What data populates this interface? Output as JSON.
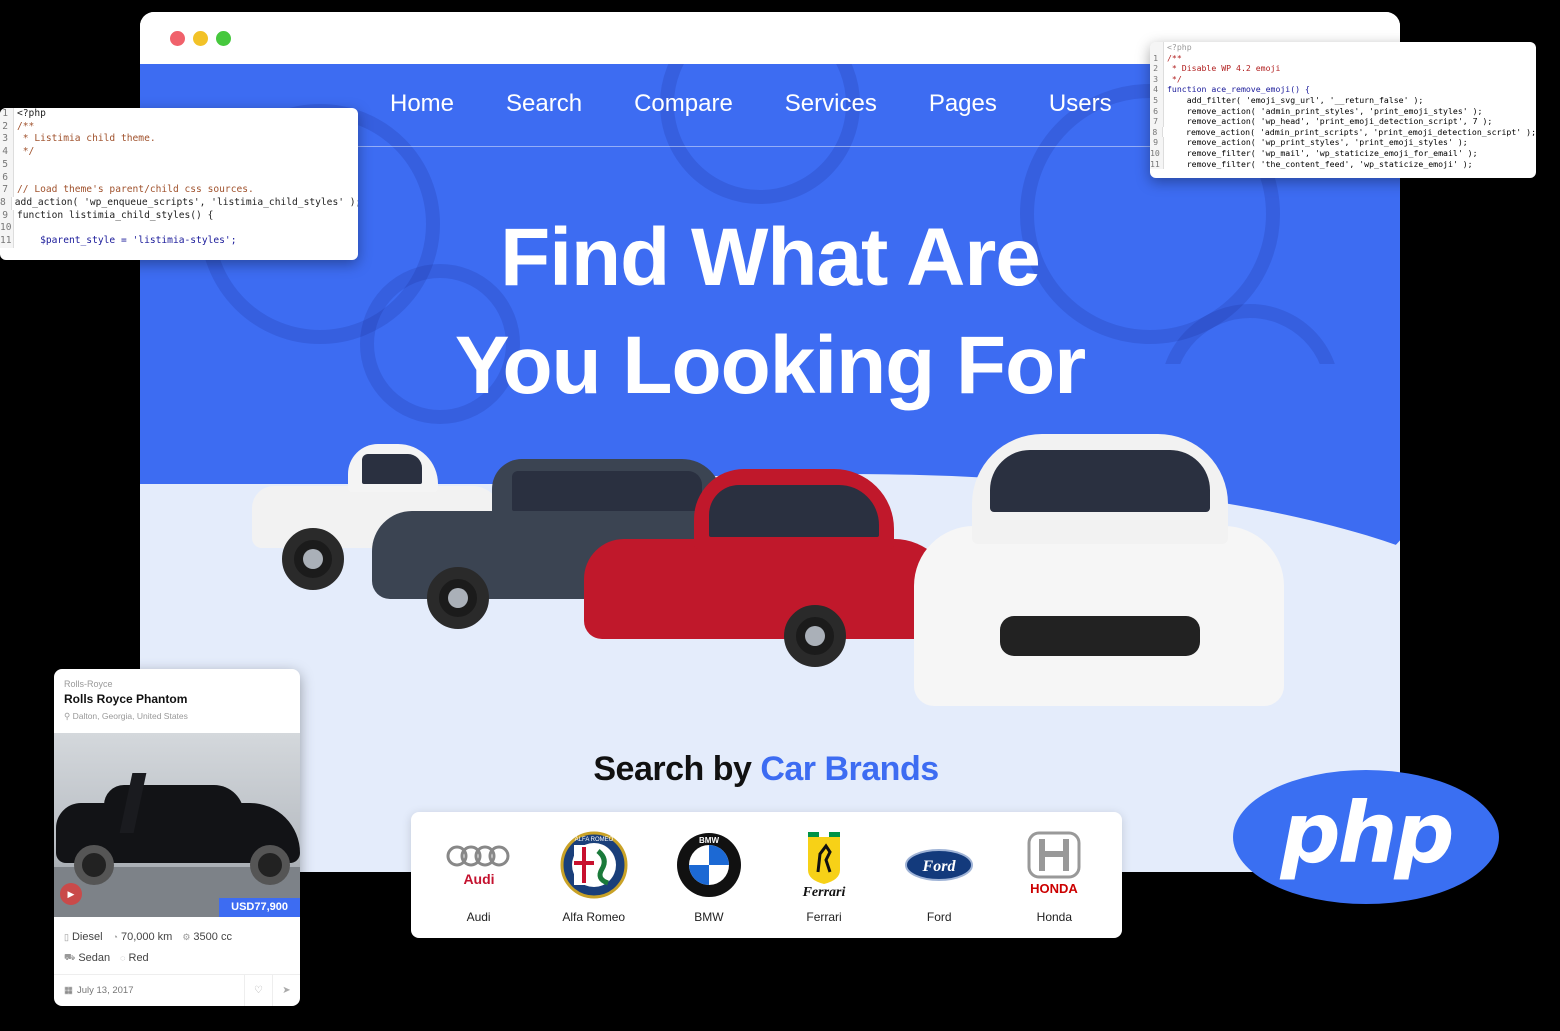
{
  "browser": {
    "nav": [
      "Home",
      "Search",
      "Compare",
      "Services",
      "Pages",
      "Users"
    ],
    "headline_line1": "Find What Are",
    "headline_line2": "You Looking For",
    "brands_heading_prefix": "Search by",
    "brands_heading_accent": "Car Brands",
    "brands": [
      {
        "name": "Audi",
        "logo_text": "Audi",
        "color": "#c4122f"
      },
      {
        "name": "Alfa Romeo",
        "logo_text": "ALFA ROMEO",
        "color": "#1a5b2b"
      },
      {
        "name": "BMW",
        "logo_text": "BMW",
        "color": "#1c69d4"
      },
      {
        "name": "Ferrari",
        "logo_text": "Ferrari",
        "color": "#f7d117"
      },
      {
        "name": "Ford",
        "logo_text": "Ford",
        "color": "#133a7c"
      },
      {
        "name": "Honda",
        "logo_text": "HONDA",
        "color": "#cc0000"
      }
    ]
  },
  "code_left": {
    "lines": [
      {
        "n": "1",
        "t": "<?php"
      },
      {
        "n": "2",
        "t": "/**"
      },
      {
        "n": "3",
        "t": " * Listimia child theme."
      },
      {
        "n": "4",
        "t": " */"
      },
      {
        "n": "5",
        "t": ""
      },
      {
        "n": "6",
        "t": ""
      },
      {
        "n": "7",
        "t": "// Load theme's parent/child css sources."
      },
      {
        "n": "8",
        "t": "add_action( 'wp_enqueue_scripts', 'listimia_child_styles' );"
      },
      {
        "n": "9",
        "t": "function listimia_child_styles() {"
      },
      {
        "n": "10",
        "t": ""
      },
      {
        "n": "11",
        "t": "    $parent_style = 'listimia-styles';"
      }
    ]
  },
  "code_right": {
    "lines": [
      {
        "n": "",
        "t": "<?php"
      },
      {
        "n": "1",
        "t": "/**"
      },
      {
        "n": "2",
        "t": " * Disable WP 4.2 emoji"
      },
      {
        "n": "3",
        "t": " */"
      },
      {
        "n": "4",
        "t": "function ace_remove_emoji() {"
      },
      {
        "n": "5",
        "t": "    add_filter( 'emoji_svg_url', '__return_false' );"
      },
      {
        "n": "6",
        "t": "    remove_action( 'admin_print_styles', 'print_emoji_styles' );"
      },
      {
        "n": "7",
        "t": "    remove_action( 'wp_head', 'print_emoji_detection_script', 7 );"
      },
      {
        "n": "8",
        "t": "    remove_action( 'admin_print_scripts', 'print_emoji_detection_script' );"
      },
      {
        "n": "9",
        "t": "    remove_action( 'wp_print_styles', 'print_emoji_styles' );"
      },
      {
        "n": "10",
        "t": "    remove_filter( 'wp_mail', 'wp_staticize_emoji_for_email' );"
      },
      {
        "n": "11",
        "t": "    remove_filter( 'the_content_feed', 'wp_staticize_emoji' );"
      }
    ]
  },
  "listing": {
    "brand": "Rolls-Royce",
    "title": "Rolls Royce Phantom",
    "location": "Dalton, Georgia, United States",
    "price": "USD77,900",
    "fuel": "Diesel",
    "mileage": "70,000 km",
    "engine": "3500 cc",
    "body": "Sedan",
    "color": "Red",
    "date": "July 13, 2017"
  },
  "php_logo": "php",
  "colors": {
    "accent": "#3d6cf2",
    "hero_light": "#e4ecfb"
  }
}
